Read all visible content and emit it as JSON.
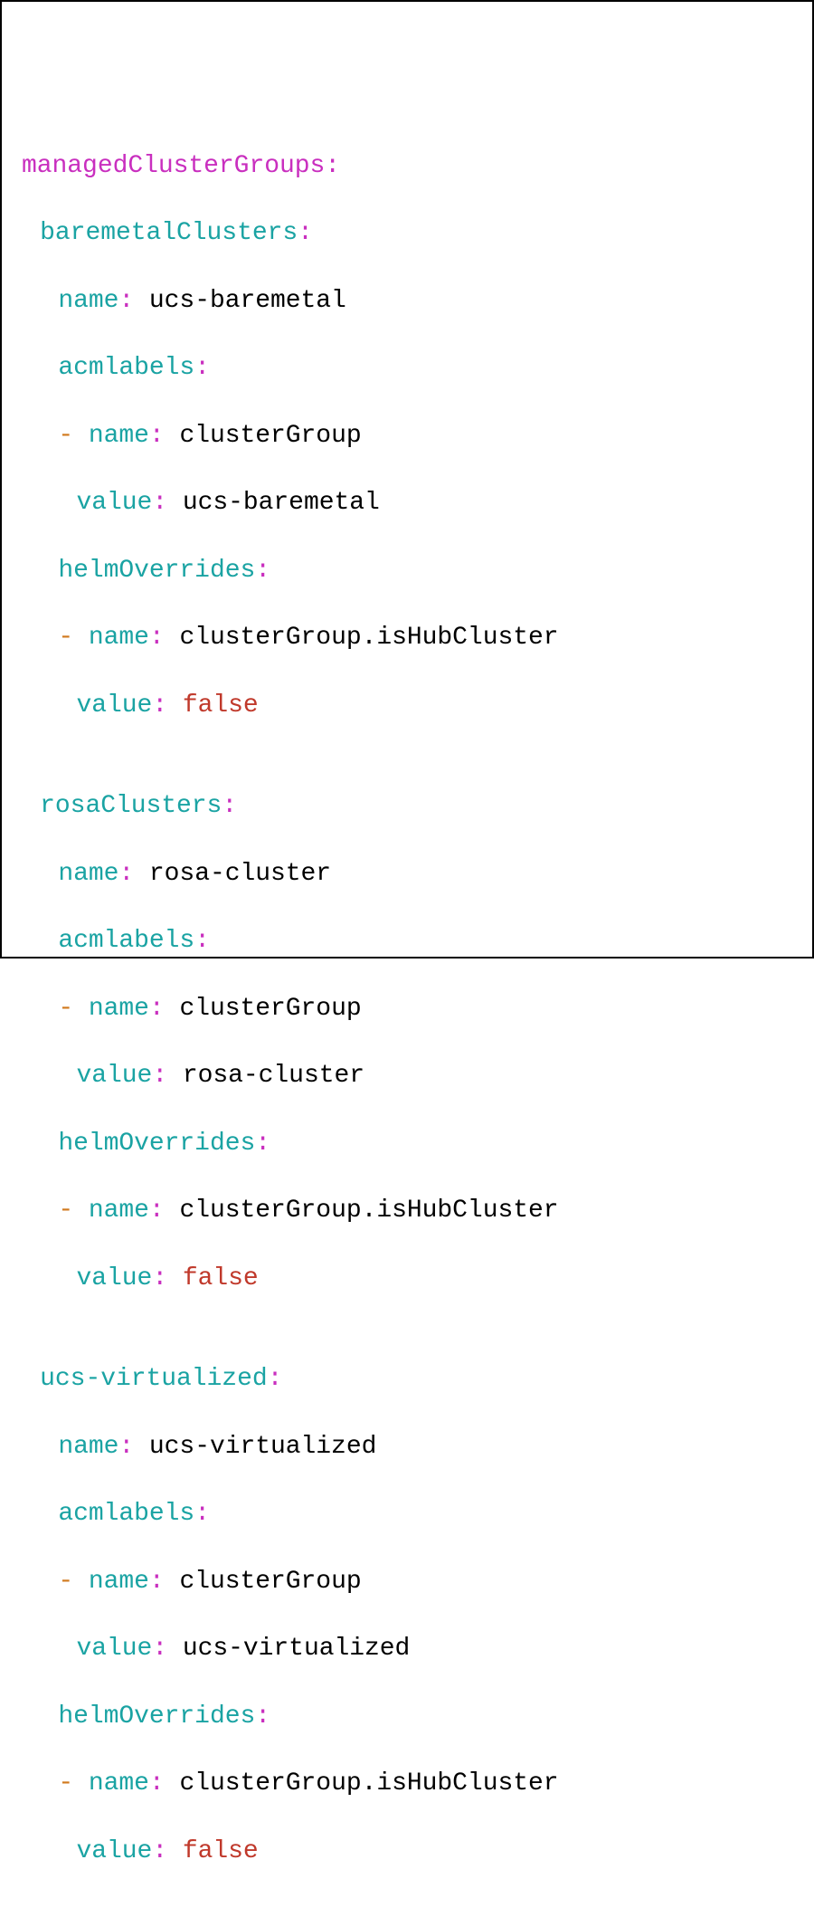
{
  "root": "managedClusterGroups",
  "groups": [
    {
      "groupKey": "baremetalClusters",
      "nameKey": "name",
      "nameValue": "ucs-baremetal",
      "acmKey": "acmlabels",
      "acmItemNameKey": "name",
      "acmItemNameValue": "clusterGroup",
      "acmItemValueKey": "value",
      "acmItemValueValue": "ucs-baremetal",
      "helmKey": "helmOverrides",
      "helmItemNameKey": "name",
      "helmItemNameValue": "clusterGroup.isHubCluster",
      "helmItemValueKey": "value",
      "helmItemValueValue": "false"
    },
    {
      "groupKey": "rosaClusters",
      "nameKey": "name",
      "nameValue": "rosa-cluster",
      "acmKey": "acmlabels",
      "acmItemNameKey": "name",
      "acmItemNameValue": "clusterGroup",
      "acmItemValueKey": "value",
      "acmItemValueValue": "rosa-cluster",
      "helmKey": "helmOverrides",
      "helmItemNameKey": "name",
      "helmItemNameValue": "clusterGroup.isHubCluster",
      "helmItemValueKey": "value",
      "helmItemValueValue": "false"
    },
    {
      "groupKey": "ucs-virtualized",
      "nameKey": "name",
      "nameValue": "ucs-virtualized",
      "acmKey": "acmlabels",
      "acmItemNameKey": "name",
      "acmItemNameValue": "clusterGroup",
      "acmItemValueKey": "value",
      "acmItemValueValue": "ucs-virtualized",
      "helmKey": "helmOverrides",
      "helmItemNameKey": "name",
      "helmItemNameValue": "clusterGroup.isHubCluster",
      "helmItemValueKey": "value",
      "helmItemValueValue": "false"
    }
  ]
}
